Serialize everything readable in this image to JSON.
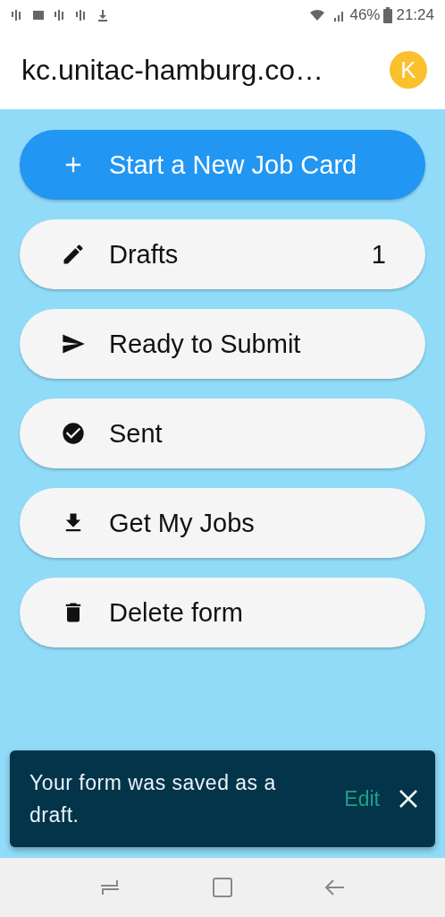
{
  "status_bar": {
    "battery": "46%",
    "time": "21:24"
  },
  "header": {
    "title": "kc.unitac-hamburg.co…",
    "avatar": "K"
  },
  "menu": [
    {
      "label": "Start a New Job Card",
      "kind": "primary"
    },
    {
      "label": "Drafts",
      "kind": "default",
      "count": "1"
    },
    {
      "label": "Ready to Submit",
      "kind": "default"
    },
    {
      "label": "Sent",
      "kind": "default"
    },
    {
      "label": "Get My Jobs",
      "kind": "default"
    },
    {
      "label": "Delete form",
      "kind": "default"
    }
  ],
  "snackbar": {
    "message": "Your form was saved as a draft.",
    "action": "Edit"
  }
}
